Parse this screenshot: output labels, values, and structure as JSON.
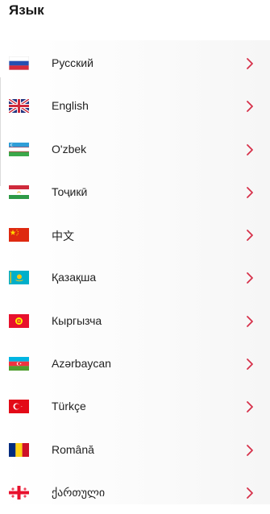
{
  "header": {
    "title": "Язык"
  },
  "accent_color": "#d6314a",
  "languages": [
    {
      "label": "Русский",
      "flag_icon": "russia-flag-icon"
    },
    {
      "label": "English",
      "flag_icon": "uk-flag-icon"
    },
    {
      "label": "O'zbek",
      "flag_icon": "uzbekistan-flag-icon"
    },
    {
      "label": "Тоҷикӣ",
      "flag_icon": "tajikistan-flag-icon"
    },
    {
      "label": "中文",
      "flag_icon": "china-flag-icon"
    },
    {
      "label": "Қазақша",
      "flag_icon": "kazakhstan-flag-icon"
    },
    {
      "label": "Кыргызча",
      "flag_icon": "kyrgyzstan-flag-icon"
    },
    {
      "label": "Azərbaycan",
      "flag_icon": "azerbaijan-flag-icon"
    },
    {
      "label": "Türkçe",
      "flag_icon": "turkey-flag-icon"
    },
    {
      "label": "Română",
      "flag_icon": "romania-flag-icon"
    },
    {
      "label": "ქართული",
      "flag_icon": "georgia-flag-icon"
    }
  ]
}
